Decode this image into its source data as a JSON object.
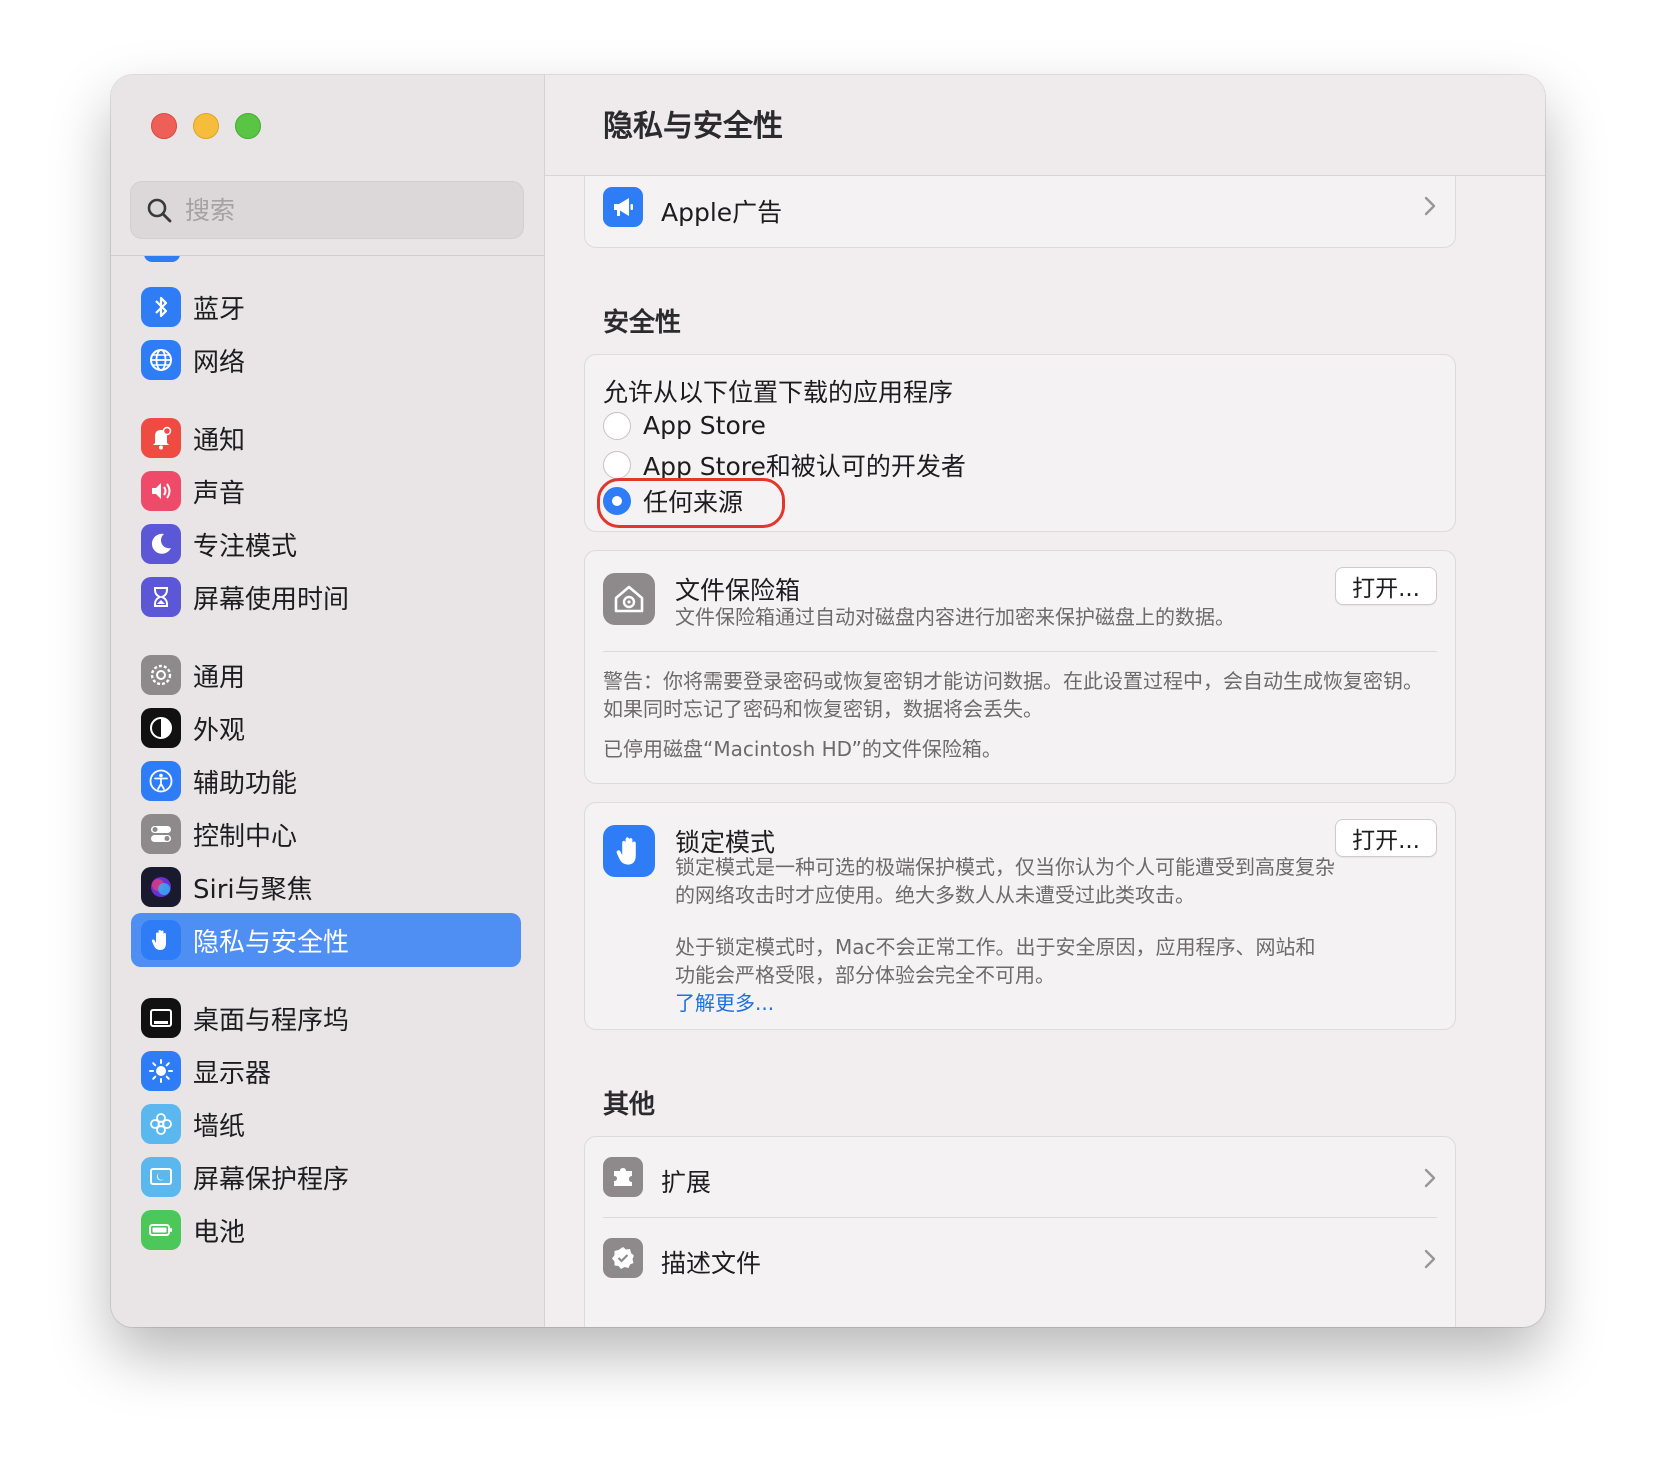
{
  "window": {
    "title": "隐私与安全性"
  },
  "search": {
    "placeholder": "搜索"
  },
  "sidebar": {
    "items": [
      {
        "label": "蓝牙"
      },
      {
        "label": "网络"
      },
      {
        "label": "通知"
      },
      {
        "label": "声音"
      },
      {
        "label": "专注模式"
      },
      {
        "label": "屏幕使用时间"
      },
      {
        "label": "通用"
      },
      {
        "label": "外观"
      },
      {
        "label": "辅助功能"
      },
      {
        "label": "控制中心"
      },
      {
        "label": "Siri与聚焦"
      },
      {
        "label": "隐私与安全性"
      },
      {
        "label": "桌面与程序坞"
      },
      {
        "label": "显示器"
      },
      {
        "label": "墙纸"
      },
      {
        "label": "屏幕保护程序"
      },
      {
        "label": "电池"
      }
    ],
    "selected": "隐私与安全性"
  },
  "main": {
    "apple_ads": {
      "label": "Apple广告"
    },
    "security": {
      "title": "安全性",
      "allow_label": "允许从以下位置下载的应用程序",
      "options": [
        {
          "label": "App Store",
          "checked": false
        },
        {
          "label": "App Store和被认可的开发者",
          "checked": false
        },
        {
          "label": "任何来源",
          "checked": true
        }
      ]
    },
    "filevault": {
      "title": "文件保险箱",
      "desc": "文件保险箱通过自动对磁盘内容进行加密来保护磁盘上的数据。",
      "button": "打开...",
      "warning": "警告：你将需要登录密码或恢复密钥才能访问数据。在此设置过程中，会自动生成恢复密钥。如果同时忘记了密码和恢复密钥，数据将会丢失。",
      "status": "已停用磁盘“Macintosh HD”的文件保险箱。"
    },
    "lockdown": {
      "title": "锁定模式",
      "desc": "锁定模式是一种可选的极端保护模式，仅当你认为个人可能遭受到高度复杂的网络攻击时才应使用。绝大多数人从未遭受过此类攻击。",
      "desc2": "处于锁定模式时，Mac不会正常工作。出于安全原因，应用程序、网站和功能会严格受限，部分体验会完全不可用。",
      "link": "了解更多...",
      "button": "打开..."
    },
    "other": {
      "title": "其他",
      "items": [
        {
          "label": "扩展"
        },
        {
          "label": "描述文件"
        }
      ]
    }
  },
  "colors": {
    "accent": "#2f7df6",
    "selection": "#4f8ef3",
    "highlight": "#e0382c"
  }
}
